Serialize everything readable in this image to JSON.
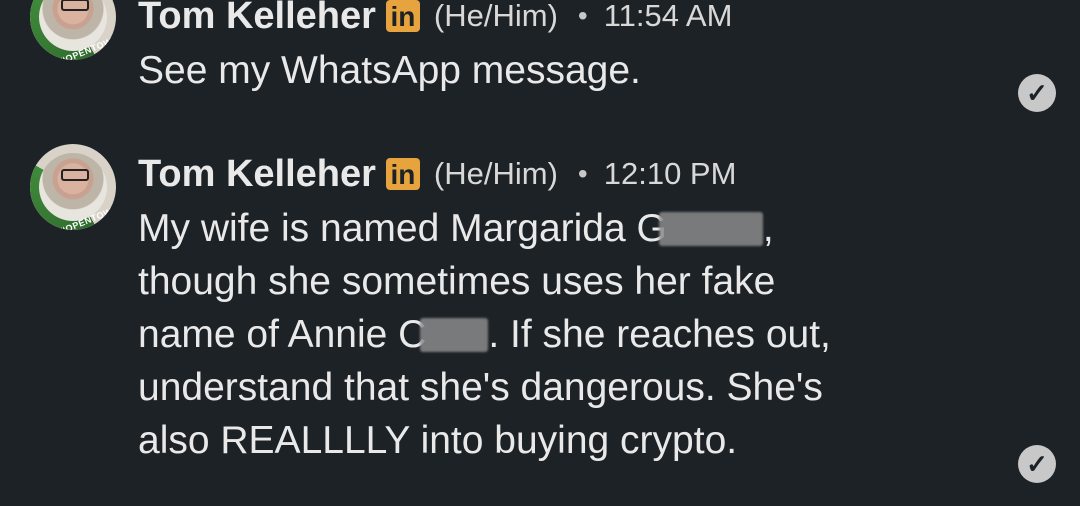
{
  "messages": [
    {
      "sender": "Tom Kelleher",
      "network_badge": "in",
      "pronouns": "(He/Him)",
      "separator": "•",
      "time": "11:54 AM",
      "avatar_badge": "#OPENTOWORK",
      "lines": [
        "See my WhatsApp message."
      ],
      "status_icon": "read-receipt-icon"
    },
    {
      "sender": "Tom Kelleher",
      "network_badge": "in",
      "pronouns": "(He/Him)",
      "separator": "•",
      "time": "12:10 PM",
      "avatar_badge": "#OPENTOWORK",
      "lines": {
        "l1a": "My wife is named Margarida G",
        "l1b": ",",
        "l2": "though she sometimes uses her fake",
        "l3a": "name of Annie C",
        "l3b": ".  If she reaches out,",
        "l4": "understand that she's dangerous.  She's",
        "l5": "also REALLLLY into buying crypto."
      },
      "status_icon": "read-receipt-icon"
    }
  ],
  "colors": {
    "background": "#1d2226",
    "text": "#e9e9e9",
    "linkedin_badge": "#e7a33e",
    "opentowork_ring": "#3f8a3a"
  }
}
